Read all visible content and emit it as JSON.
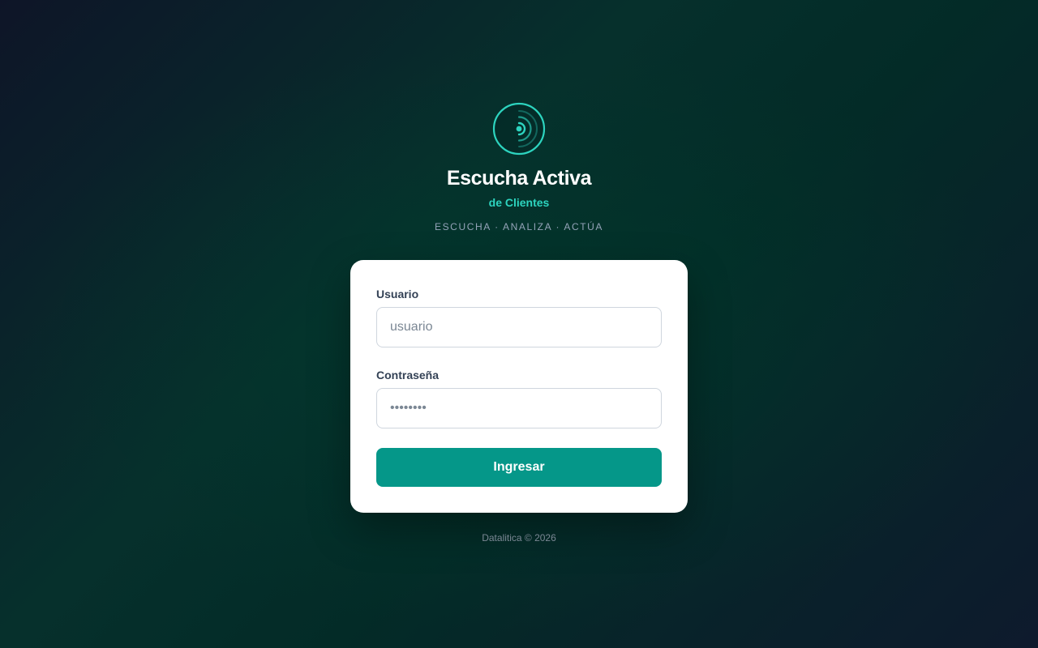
{
  "brand": {
    "logo_icon": "signal-waves-icon",
    "title": "Escucha Activa",
    "subtitle": "de Clientes",
    "tagline": "ESCUCHA · ANALIZA · ACTÚA",
    "accent_color": "#2dd4bf"
  },
  "login_form": {
    "username": {
      "label": "Usuario",
      "value": "",
      "placeholder": "usuario"
    },
    "password": {
      "label": "Contraseña",
      "value": "",
      "placeholder": "••••••••"
    },
    "submit_label": "Ingresar",
    "button_color": "#059789"
  },
  "footer": {
    "text": "Datalitica © 2026"
  }
}
